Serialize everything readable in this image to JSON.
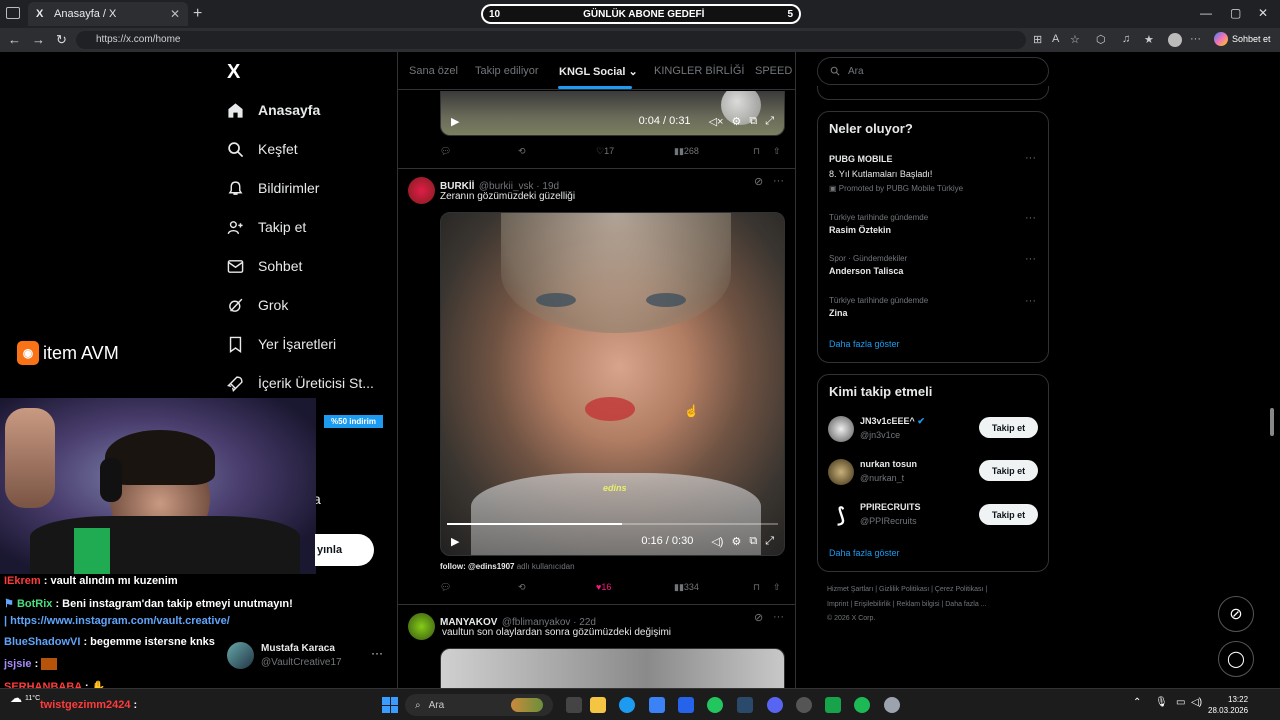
{
  "browser": {
    "tab_title": "Anasayfa / X",
    "tab_favicon": "X",
    "url": "https://x.com/home",
    "sohbet_label": "Sohbet et",
    "goal_left": "10",
    "goal_title": "GÜNLÜK ABONE GEDEFİ",
    "goal_right": "5"
  },
  "nav": {
    "logo": "X",
    "items": [
      {
        "label": "Anasayfa",
        "icon": "home-icon"
      },
      {
        "label": "Keşfet",
        "icon": "search-icon"
      },
      {
        "label": "Bildirimler",
        "icon": "bell-icon"
      },
      {
        "label": "Takip et",
        "icon": "follow-icon"
      },
      {
        "label": "Sohbet",
        "icon": "mail-icon"
      },
      {
        "label": "Grok",
        "icon": "grok-icon"
      },
      {
        "label": "Yer İşaretleri",
        "icon": "bookmark-icon"
      },
      {
        "label": "İçerik Üreticisi St...",
        "icon": "rocket-icon"
      }
    ],
    "partial_more": "a",
    "post_button_partial": "yınla",
    "profile_name": "Mustafa Karaca",
    "profile_handle": "@VaultCreative17"
  },
  "feed": {
    "tabs": [
      "Sana özel",
      "Takip ediliyor",
      "KNGL Social",
      "KINGLER BİRLİĞİ",
      "SPEED G"
    ],
    "active_tab": "KNGL Social",
    "post0": {
      "time": "0:04 / 0:31",
      "progress": 0.13,
      "replies": "",
      "retweets": "",
      "likes": "17",
      "views": "268"
    },
    "post1": {
      "name": "BURKİİ",
      "handle": "@burkii_vsk · 19d",
      "text": "Zeranın gözümüzdeki güzelliği",
      "watermark": "edins",
      "time": "0:16 / 0:30",
      "progress": 0.53,
      "caption_bold": "follow: @edins1907",
      "caption_rest": "adlı kullanıcıdan",
      "likes": "16",
      "views": "334"
    },
    "post2": {
      "name": "MANYAKOV",
      "handle": "@fblimanyakov · 22d",
      "text": "vaultun son olaylardan sonra gözümüzdeki değişimi"
    }
  },
  "right": {
    "search_placeholder": "Ara",
    "trends_title": "Neler oluyor?",
    "trends": [
      {
        "meta": "",
        "name": "PUBG MOBILE",
        "sub": "8. Yıl Kutlamaları Başladı!",
        "promo": "Promoted by PUBG Mobile Türkiye"
      },
      {
        "meta": "Türkiye tarihinde gündemde",
        "name": "Rasim Öztekin"
      },
      {
        "meta": "Spor · Gündemdekiler",
        "name": "Anderson Talisca"
      },
      {
        "meta": "Türkiye tarihinde gündemde",
        "name": "Zina"
      }
    ],
    "show_more": "Daha fazla göster",
    "who_title": "Kimi takip etmeli",
    "who": [
      {
        "name": "JN3v1cEEE^",
        "handle": "@jn3v1ce",
        "button": "Takip et"
      },
      {
        "name": "nurkan tosun",
        "handle": "@nurkan_t",
        "button": "Takip et"
      },
      {
        "name": "PPIRECRUITS",
        "handle": "@PPIRecruits",
        "button": "Takip et"
      }
    ],
    "footer_line1": "Hizmet Şartları  |  Gizlilik Politikası  |  Çerez Politikası  |",
    "footer_line2": "Imprint  |  Erişilebilirlik  |  Reklam bilgisi  |  Daha fazla ...",
    "footer_line3": "© 2026 X Corp."
  },
  "overlay": {
    "logo_prefix": "item",
    "logo_suffix": "AVM",
    "discount": "%50 indirim",
    "chat": [
      {
        "user": "IEkrem",
        "msg": " : vault alındın mı kuzenim",
        "color": "#ff3b3b"
      },
      {
        "user": "BotRix",
        "msg": " : Beni instagram'dan takip etmeyi unutmayın!",
        "color": "#4ade80"
      },
      {
        "user": "",
        "msg": "| https://www.instagram.com/vault.creative/",
        "color": "#60a5fa"
      },
      {
        "user": "BlueShadowVI",
        "msg": " : begemme istersne knks",
        "color": "#60a5fa"
      },
      {
        "user": "jsjsie",
        "msg": " : ",
        "color": "#a78bfa"
      },
      {
        "user": "SERHANBABA",
        "msg": " : ",
        "color": "#ff3b3b"
      },
      {
        "user": "twistgezimm2424",
        "msg": " : ",
        "color": "#ff3b3b"
      }
    ]
  },
  "taskbar": {
    "search": "Ara",
    "weather": "11°C",
    "time": "13:22",
    "date": "28.03.2026"
  }
}
